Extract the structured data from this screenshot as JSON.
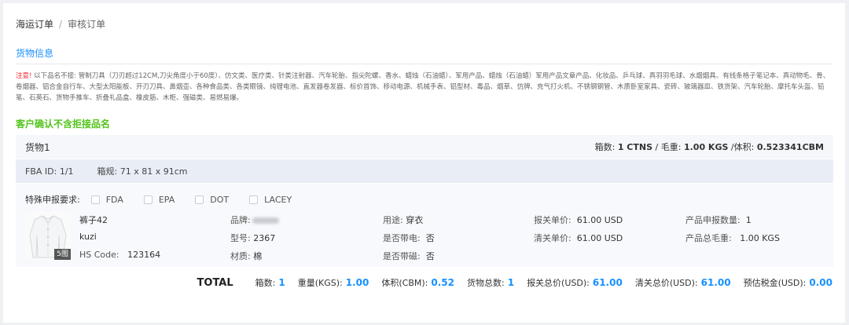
{
  "breadcrumb": {
    "root": "海运订单",
    "separator": "/",
    "current": "审核订单"
  },
  "section_title": "货物信息",
  "notice": {
    "label": "注意!",
    "text": "以下品名不接: 管制刀具（刀刃超过12CM,刀尖角度小于60度）、仿文类、医疗类、针类注射器、汽车轮胎、指尖陀螺、香水、蜡烛（石油蜡）、军用产品、蜡烛（石油蜡）军用产品文章产品、化妆品、乒乓球、真羽羽毛球、水烟烟具、有线条格子笔记本、真动物毛、骨、卷烟器、铝合金自行车、大型太阳能板、开刃刀具、鼻烟壶、各种食品类、各类眼镜、纯锂电池、直发器卷发器、标价首饰、移动电源、机械手表、铝型材、毒品、烟草、仿牌、充气打火机、不锈钢钢管、木质卧室家具、瓷砖、玻璃器皿、铁货架、汽车轮胎、摩托车头盔、铅笔、石英石、货物手推车、折叠礼品盒、橡皮筋、木柜、强磁类、易燃易爆。"
  },
  "confirm_text": "客户确认不含拒接品名",
  "goods": {
    "title": "货物1",
    "summary": {
      "boxes_label": "箱数:",
      "boxes_value": "1 CTNS",
      "sep1": "/",
      "weight_label": "毛重:",
      "weight_value": "1.00 KGS",
      "volume_label": "/体积:",
      "volume_value": "0.523341CBM"
    },
    "fba": {
      "id_label": "FBA ID:",
      "id_value": "1/1",
      "size_label": "箱规:",
      "size_value": "71 x 81 x 91cm"
    },
    "special": {
      "label": "特殊申报要求:",
      "options": [
        "FDA",
        "EPA",
        "DOT",
        "LACEY"
      ]
    },
    "image_badge": "5图",
    "item": {
      "name": "裤子42",
      "name_en": "kuzi",
      "hs_label": "HS Code:",
      "hs_value": "123164",
      "brand_label": "品牌:",
      "model_label": "型号:",
      "model_value": "2367",
      "material_label": "材质:",
      "material_value": "棉",
      "usage_label": "用途:",
      "usage_value": "穿衣",
      "battery_label": "是否带电:",
      "battery_value": "否",
      "magnet_label": "是否带磁:",
      "magnet_value": "否",
      "unit_price_label": "报关单价:",
      "unit_price_value": "61.00 USD",
      "clear_price_label": "清关单价:",
      "clear_price_value": "61.00 USD",
      "qty_label": "产品申报数量:",
      "qty_value": "1",
      "gross_label": "产品总毛重:",
      "gross_value": "1.00 KGS"
    }
  },
  "totals": {
    "title": "TOTAL",
    "items": [
      {
        "label": "箱数:",
        "value": "1"
      },
      {
        "label": "重量(KGS):",
        "value": "1.00"
      },
      {
        "label": "体积(CBM):",
        "value": "0.52"
      },
      {
        "label": "货物总数:",
        "value": "1"
      },
      {
        "label": "报关总价(USD):",
        "value": "61.00"
      },
      {
        "label": "清关总价(USD):",
        "value": "61.00"
      },
      {
        "label": "预估税金(USD):",
        "value": "0.00"
      }
    ]
  },
  "colors": {
    "accent": "#1890ff",
    "confirm": "#52c41a",
    "notice": "#f5222d"
  }
}
